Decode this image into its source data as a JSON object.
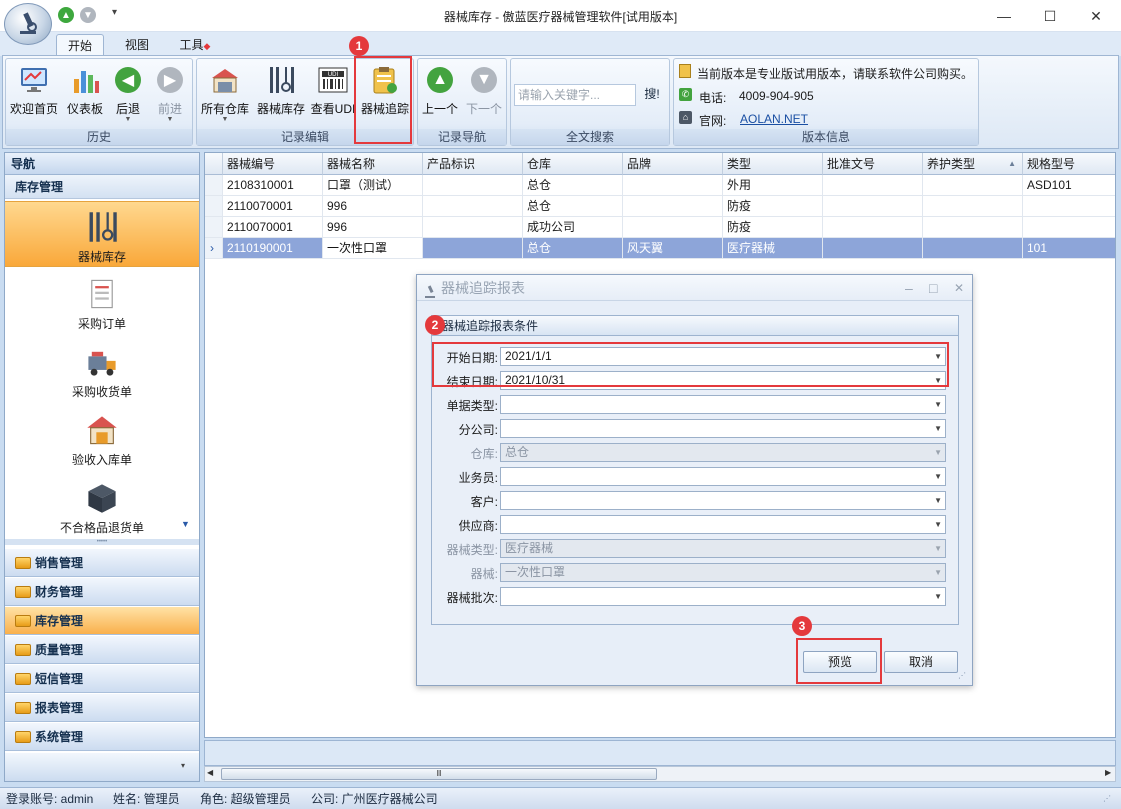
{
  "window": {
    "title": "器械库存 - 傲蓝医疗器械管理软件[试用版本]",
    "minimize": "—",
    "maximize": "☐",
    "close": "✕"
  },
  "quick_access": {
    "up": "▲",
    "down": "▼",
    "menu": "▾"
  },
  "tabs": [
    {
      "label": "开始"
    },
    {
      "label": "视图"
    },
    {
      "label": "工具"
    }
  ],
  "ribbon": {
    "groups": [
      {
        "caption": "历史",
        "buttons": [
          {
            "label": "欢迎首页"
          },
          {
            "label": "仪表板"
          },
          {
            "label": "后退"
          },
          {
            "label": "前进"
          }
        ]
      },
      {
        "caption": "记录编辑",
        "buttons": [
          {
            "label": "所有仓库"
          },
          {
            "label": "器械库存"
          },
          {
            "label": "查看UDI"
          },
          {
            "label": "器械追踪"
          }
        ]
      },
      {
        "caption": "记录导航",
        "buttons": [
          {
            "label": "上一个"
          },
          {
            "label": "下一个"
          }
        ]
      },
      {
        "caption": "全文搜索",
        "search_placeholder": "请输入关键字...",
        "search_button": "搜!"
      },
      {
        "caption": "版本信息",
        "notice": "当前版本是专业版试用版本，请联系软件公司购买。",
        "phone_label": "电话:",
        "phone": "4009-904-905",
        "site_label": "官网:",
        "site": "AOLAN.NET"
      }
    ]
  },
  "nav": {
    "header": "导航",
    "section": "库存管理",
    "items": [
      {
        "label": "器械库存",
        "icon": "instruments-icon"
      },
      {
        "label": "采购订单",
        "icon": "document-icon"
      },
      {
        "label": "采购收货单",
        "icon": "truck-icon"
      },
      {
        "label": "验收入库单",
        "icon": "warehouse-icon"
      },
      {
        "label": "不合格品退货单",
        "icon": "box-icon"
      }
    ],
    "groups": [
      {
        "label": "销售管理"
      },
      {
        "label": "财务管理"
      },
      {
        "label": "库存管理"
      },
      {
        "label": "质量管理"
      },
      {
        "label": "短信管理"
      },
      {
        "label": "报表管理"
      },
      {
        "label": "系统管理"
      }
    ]
  },
  "grid": {
    "columns": [
      "器械编号",
      "器械名称",
      "产品标识",
      "仓库",
      "品牌",
      "类型",
      "批准文号",
      "养护类型",
      "规格型号"
    ],
    "rows": [
      [
        "2108310001",
        "口罩（测试）",
        "",
        "总仓",
        "",
        "外用",
        "",
        "",
        "ASD101"
      ],
      [
        "2110070001",
        "996",
        "",
        "总仓",
        "",
        "防疫",
        "",
        "",
        ""
      ],
      [
        "2110070001",
        "996",
        "",
        "成功公司",
        "",
        "防疫",
        "",
        "",
        ""
      ],
      [
        "2110190001",
        "一次性口罩",
        "",
        "总仓",
        "风天翼",
        "医疗器械",
        "",
        "",
        "101"
      ]
    ],
    "selected_row": 3,
    "row_indicator": "›",
    "hscroll_grip": "Ⅲ"
  },
  "dialog": {
    "title": "器械追踪报表",
    "panel_title": "器械追踪报表条件",
    "fields": [
      {
        "label": "开始日期:",
        "value": "2021/1/1",
        "enabled": true
      },
      {
        "label": "结束日期:",
        "value": "2021/10/31",
        "enabled": true
      },
      {
        "label": "单据类型:",
        "value": "",
        "enabled": true
      },
      {
        "label": "分公司:",
        "value": "",
        "enabled": true
      },
      {
        "label": "仓库:",
        "value": "总仓",
        "enabled": false
      },
      {
        "label": "业务员:",
        "value": "",
        "enabled": true
      },
      {
        "label": "客户:",
        "value": "",
        "enabled": true
      },
      {
        "label": "供应商:",
        "value": "",
        "enabled": true
      },
      {
        "label": "器械类型:",
        "value": "医疗器械",
        "enabled": false
      },
      {
        "label": "器械:",
        "value": "一次性口罩",
        "enabled": false
      },
      {
        "label": "器械批次:",
        "value": "",
        "enabled": true
      }
    ],
    "preview_button": "预览",
    "cancel_button": "取消",
    "min": "–",
    "max": "□",
    "close": "✕"
  },
  "badges": [
    "1",
    "2",
    "3"
  ],
  "status": {
    "account": "登录账号: admin",
    "name": "姓名: 管理员",
    "role": "角色: 超级管理员",
    "company": "公司: 广州医疗器械公司"
  },
  "colors": {
    "highlight": "#e4393c",
    "selection": "#8da5d9",
    "nav_active": "#f9a83a"
  }
}
